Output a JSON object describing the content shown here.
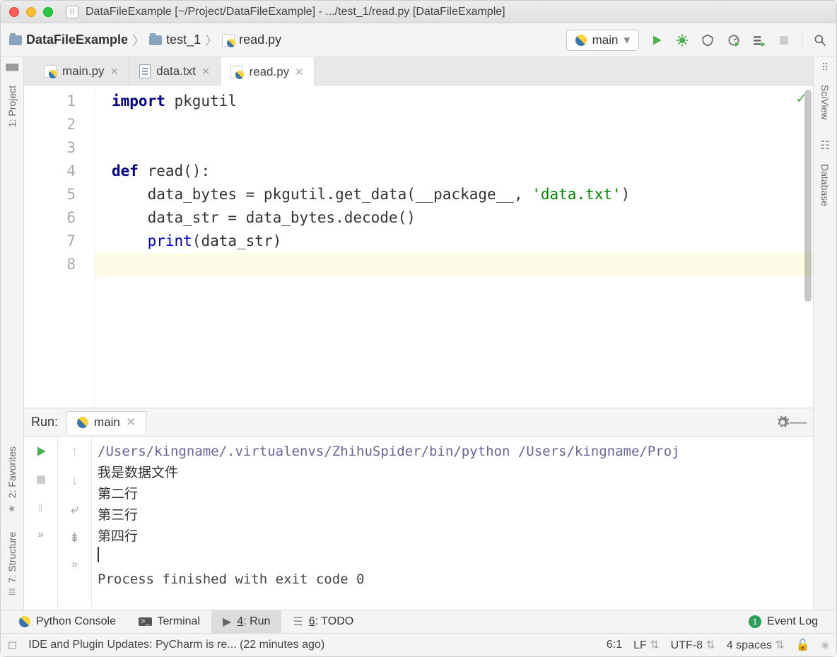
{
  "title": "DataFileExample [~/Project/DataFileExample] - .../test_1/read.py [DataFileExample]",
  "breadcrumbs": [
    {
      "label": "DataFileExample",
      "type": "project"
    },
    {
      "label": "test_1",
      "type": "folder"
    },
    {
      "label": "read.py",
      "type": "pyfile"
    }
  ],
  "run_config": {
    "selected": "main"
  },
  "tabs": [
    {
      "label": "main.py",
      "type": "py",
      "active": false
    },
    {
      "label": "data.txt",
      "type": "txt",
      "active": false
    },
    {
      "label": "read.py",
      "type": "py",
      "active": true
    }
  ],
  "editor": {
    "line_numbers": [
      "1",
      "2",
      "3",
      "4",
      "5",
      "6",
      "7",
      "8"
    ],
    "lines": {
      "1_import": "import",
      "1_pkg": " pkgutil",
      "4_def": "def",
      "4_name": " read():",
      "5": "    data_bytes = pkgutil.get_data(__package__, ",
      "5_str": "'data.txt'",
      "5_end": ")",
      "6": "    data_str = data_bytes.decode()",
      "7_print": "print",
      "7_rest": "(data_str)"
    }
  },
  "run_panel": {
    "title": "Run:",
    "tab": "main",
    "output_cmd": "/Users/kingname/.virtualenvs/ZhihuSpider/bin/python /Users/kingname/Proj",
    "output_lines": [
      "我是数据文件",
      "第二行",
      "第三行",
      "第四行"
    ],
    "exit": "Process finished with exit code 0"
  },
  "left_rail": {
    "project": "1: Project",
    "favorites": "2: Favorites",
    "structure": "7: Structure"
  },
  "right_rail": {
    "sciview": "SciView",
    "database": "Database"
  },
  "bottom_bar": {
    "python_console": "Python Console",
    "terminal": "Terminal",
    "run": "4: Run",
    "todo": "6: TODO",
    "event_log": "Event Log",
    "event_badge": "1"
  },
  "statusbar": {
    "message": "IDE and Plugin Updates: PyCharm is re... (22 minutes ago)",
    "pos": "6:1",
    "sep": "LF",
    "enc": "UTF-8",
    "indent": "4 spaces"
  }
}
